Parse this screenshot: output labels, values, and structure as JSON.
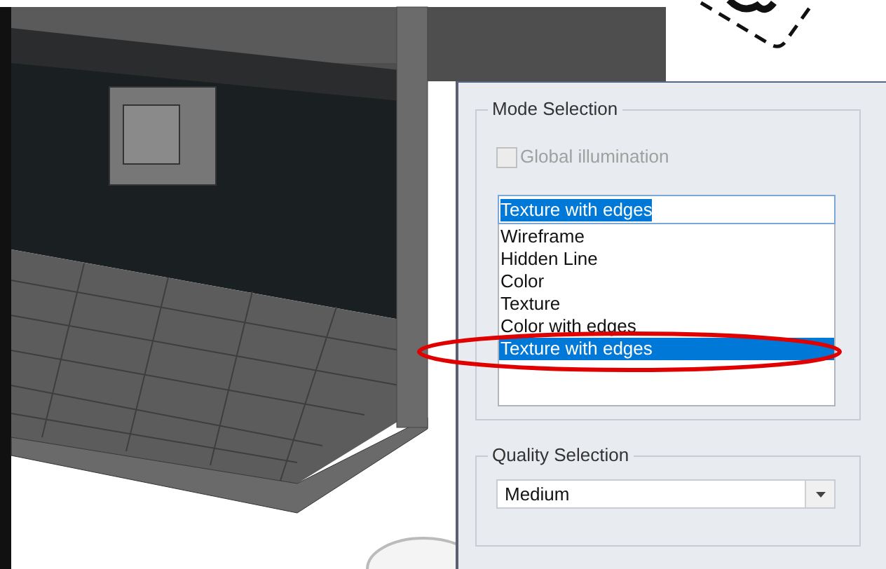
{
  "mode_selection": {
    "title": "Mode Selection",
    "global_illumination": {
      "label": "Global illumination",
      "checked": false,
      "disabled": true
    },
    "mode_field": {
      "value": "Texture with edges"
    },
    "modes": [
      {
        "label": "Wireframe",
        "selected": false
      },
      {
        "label": "Hidden Line",
        "selected": false
      },
      {
        "label": "Color",
        "selected": false
      },
      {
        "label": "Texture",
        "selected": false
      },
      {
        "label": "Color with edges",
        "selected": false
      },
      {
        "label": "Texture with edges",
        "selected": true
      }
    ]
  },
  "quality_selection": {
    "title": "Quality Selection",
    "value": "Medium"
  }
}
